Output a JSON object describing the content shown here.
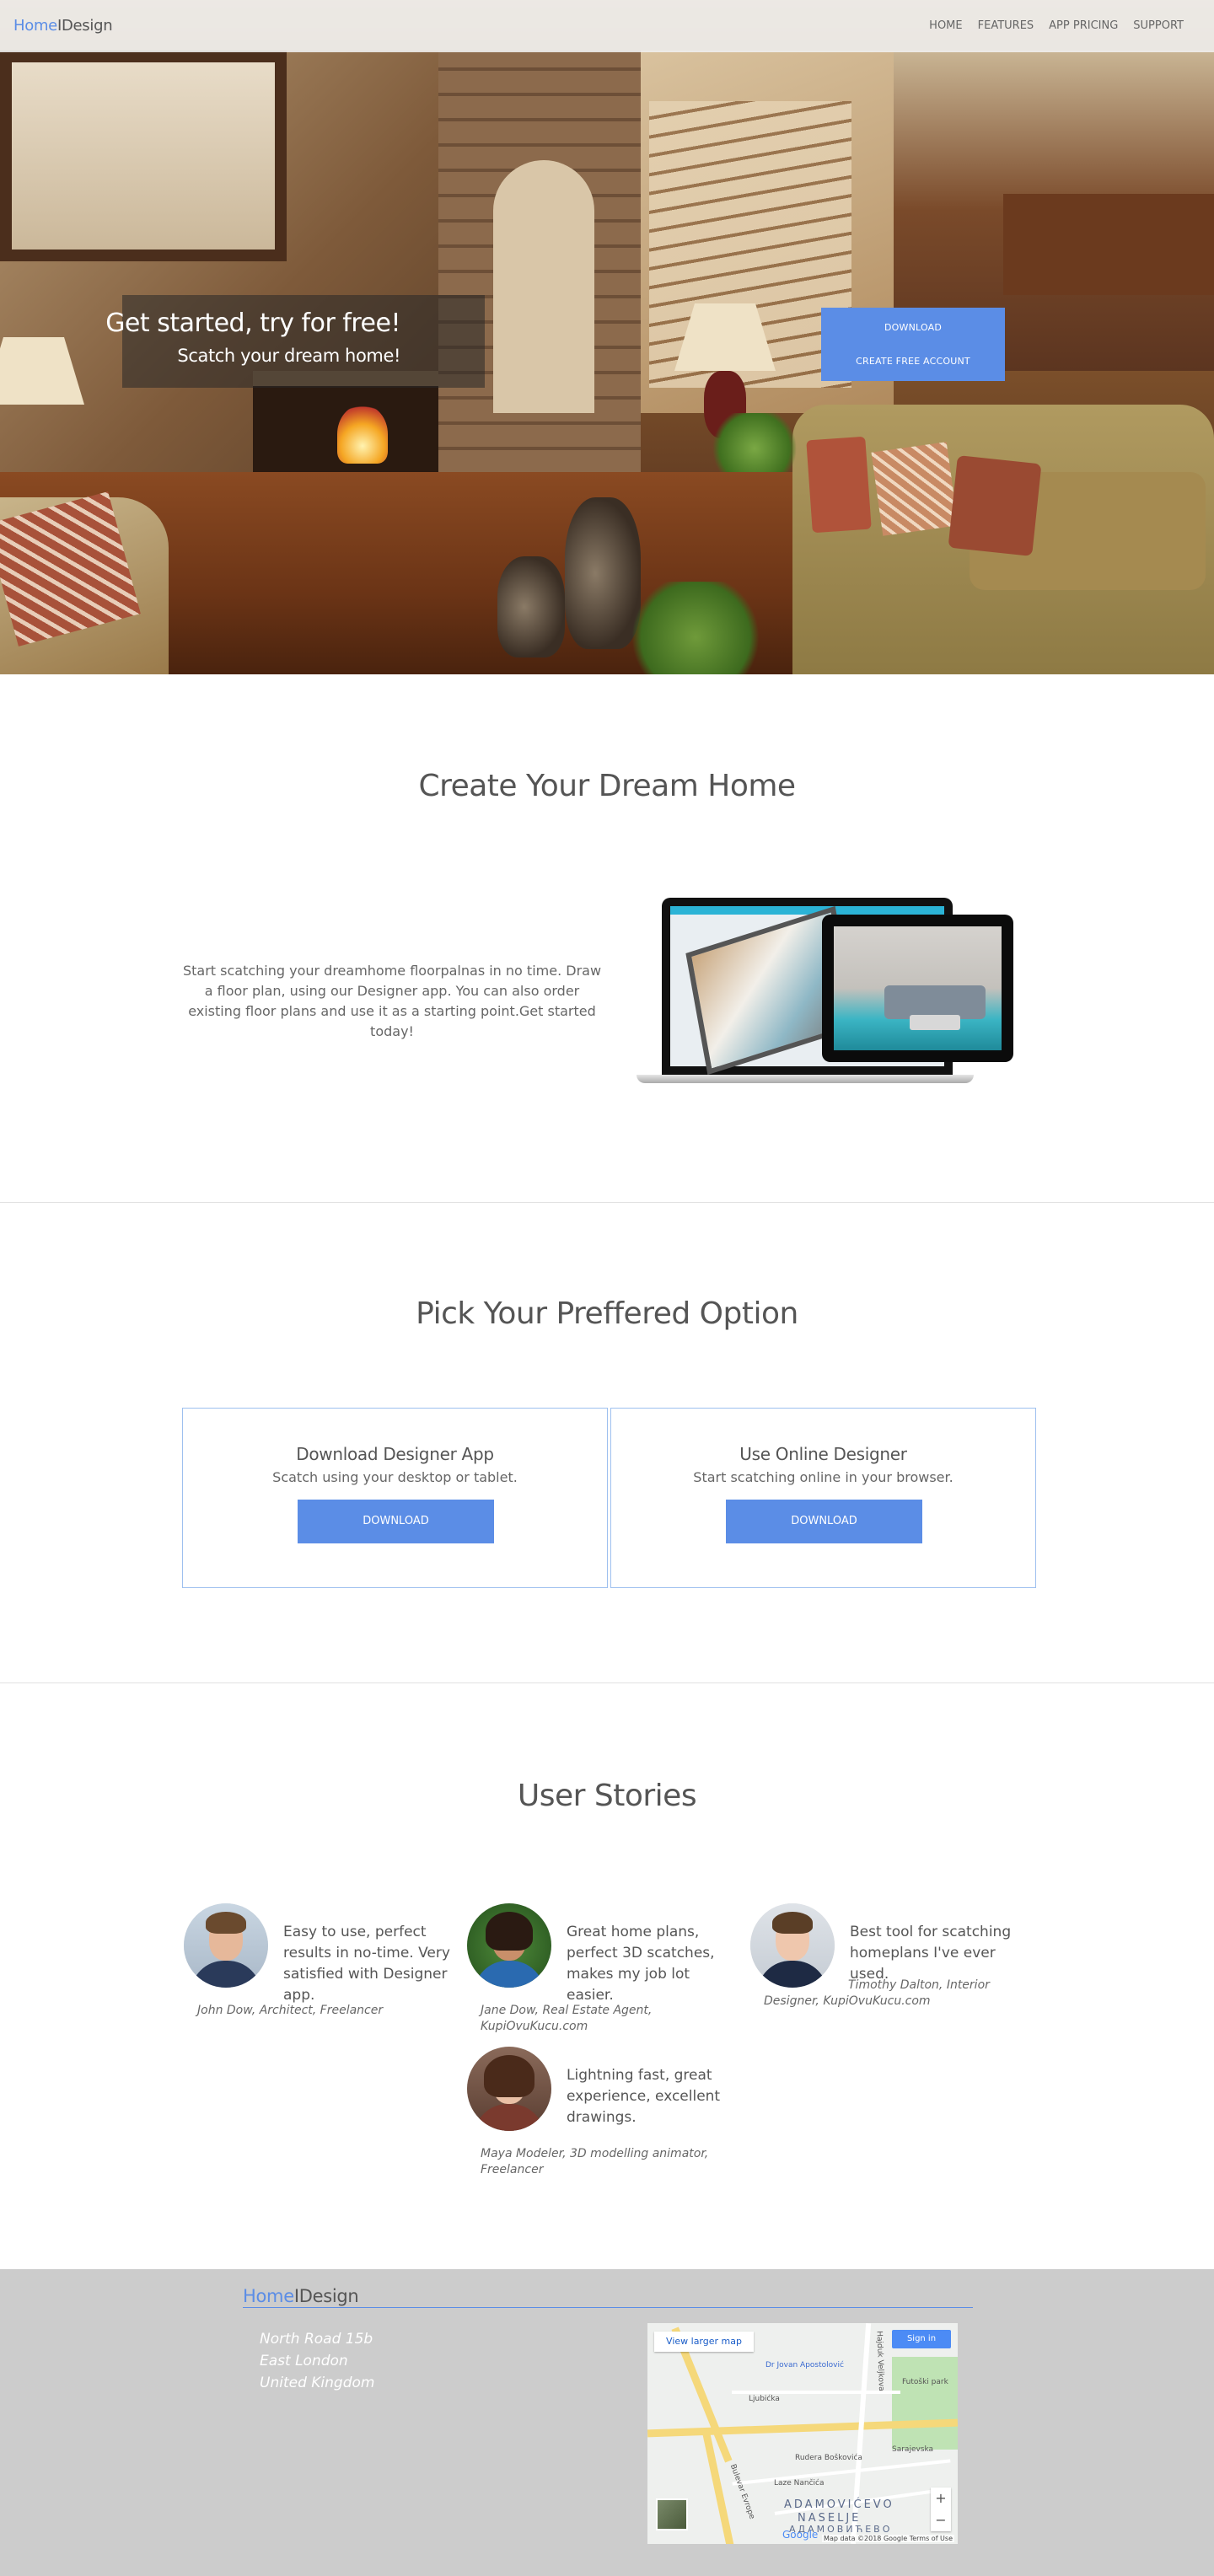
{
  "nav": {
    "logo_part1": "Home",
    "logo_part2": "IDesign",
    "items": [
      "HOME",
      "FEATURES",
      "APP PRICING",
      "SUPPORT"
    ]
  },
  "hero": {
    "title": "Get started, try for free!",
    "subtitle": "Scatch your dream home!",
    "download_label": "DOWNLOAD",
    "create_account_label": "CREATE FREE ACCOUNT"
  },
  "create": {
    "title": "Create Your Dream Home",
    "text": "Start scatching your dreamhome floorpalnas in no time. Draw a floor plan, using our Designer app. You can also order existing floor plans and use it as a starting point.Get started today!"
  },
  "options": {
    "title": "Pick Your Preffered Option",
    "items": [
      {
        "title": "Download Designer App",
        "subtitle": "Scatch using your desktop or tablet.",
        "button": "DOWNLOAD"
      },
      {
        "title": "Use Online Designer",
        "subtitle": "Start scatching online in your browser.",
        "button": "DOWNLOAD"
      }
    ]
  },
  "stories": {
    "title": "User Stories",
    "items": [
      {
        "quote": "Easy to use, perfect results in no-time. Very satisfied with Designer app.",
        "author": "John Dow, Architect, Freelancer"
      },
      {
        "quote": "Great home plans, perfect 3D scatches, makes my job lot easier.",
        "author": "Jane Dow, Real Estate Agent, KupiOvuKucu.com"
      },
      {
        "quote": "Best tool for scatching homeplans I've ever used.",
        "author": "Timothy Dalton, Interior Designer, KupiOvuKucu.com"
      },
      {
        "quote": "Lightning fast, great experience, excellent drawings.",
        "author": "Maya Modeler, 3D modelling animator, Freelancer"
      }
    ]
  },
  "footer": {
    "logo_part1": "Home",
    "logo_part2": "IDesign",
    "address": [
      "North Road 15b",
      "East London",
      "United Kingdom"
    ],
    "map": {
      "view_larger": "View larger map",
      "sign_in": "Sign in",
      "place": "Dr Jovan Apostolović",
      "park": "Futoški park",
      "streets": [
        "Ljubićka",
        "Rudera Boškovića",
        "Laze Nančića",
        "Sarajevska",
        "Bulevar Evrope",
        "Hajduk Veljkova"
      ],
      "district_line1": "ADAMOVIĆEVO",
      "district_line2": "NASELJE",
      "district_line3": "АДАМОВИЋЕВО",
      "credits": "Map data ©2018 Google   Terms of Use",
      "google": "Google",
      "zoom_in": "+",
      "zoom_out": "−"
    }
  }
}
